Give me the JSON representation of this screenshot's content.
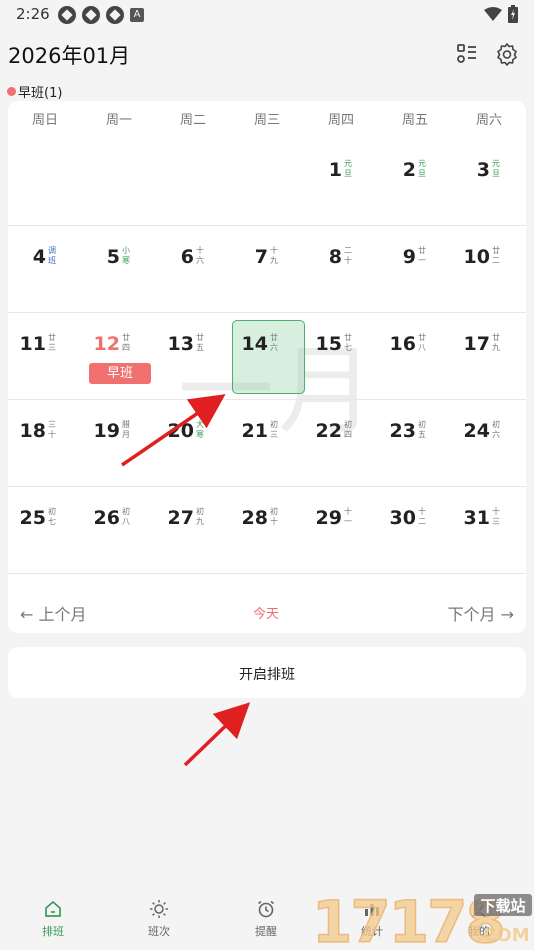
{
  "status_bar": {
    "time": "2:26"
  },
  "header": {
    "title": "2026年01月",
    "layout_icon": "list-grid-icon",
    "settings_icon": "gear-icon"
  },
  "legend": {
    "label": "早班(1)",
    "color": "#f07070"
  },
  "calendar": {
    "weekdays": [
      "周日",
      "周一",
      "周二",
      "周三",
      "周四",
      "周五",
      "周六"
    ],
    "watermark": "一月",
    "weeks": [
      [
        null,
        null,
        null,
        null,
        {
          "day": "1",
          "lunar": "元旦",
          "kind": "festival"
        },
        {
          "day": "2",
          "lunar": "元旦",
          "kind": "festival"
        },
        {
          "day": "3",
          "lunar": "元旦",
          "kind": "festival"
        }
      ],
      [
        {
          "day": "4",
          "lunar": "调班",
          "kind": "holiday"
        },
        {
          "day": "5",
          "lunar": "小寒",
          "kind": "festival"
        },
        {
          "day": "6",
          "lunar": "十六",
          "kind": "normal"
        },
        {
          "day": "7",
          "lunar": "十九",
          "kind": "normal"
        },
        {
          "day": "8",
          "lunar": "二十",
          "kind": "normal"
        },
        {
          "day": "9",
          "lunar": "廿一",
          "kind": "normal"
        },
        {
          "day": "10",
          "lunar": "廿二",
          "kind": "normal"
        }
      ],
      [
        {
          "day": "11",
          "lunar": "廿三",
          "kind": "normal"
        },
        {
          "day": "12",
          "lunar": "廿四",
          "kind": "today",
          "shift": "早班"
        },
        {
          "day": "13",
          "lunar": "廿五",
          "kind": "normal"
        },
        {
          "day": "14",
          "lunar": "廿六",
          "kind": "selected"
        },
        {
          "day": "15",
          "lunar": "廿七",
          "kind": "normal"
        },
        {
          "day": "16",
          "lunar": "廿八",
          "kind": "normal"
        },
        {
          "day": "17",
          "lunar": "廿九",
          "kind": "normal"
        }
      ],
      [
        {
          "day": "18",
          "lunar": "三十",
          "kind": "normal"
        },
        {
          "day": "19",
          "lunar": "腊月",
          "kind": "normal"
        },
        {
          "day": "20",
          "lunar": "大寒",
          "kind": "festival"
        },
        {
          "day": "21",
          "lunar": "初三",
          "kind": "normal"
        },
        {
          "day": "22",
          "lunar": "初四",
          "kind": "normal"
        },
        {
          "day": "23",
          "lunar": "初五",
          "kind": "normal"
        },
        {
          "day": "24",
          "lunar": "初六",
          "kind": "normal"
        }
      ],
      [
        {
          "day": "25",
          "lunar": "初七",
          "kind": "normal"
        },
        {
          "day": "26",
          "lunar": "初八",
          "kind": "normal"
        },
        {
          "day": "27",
          "lunar": "初九",
          "kind": "normal"
        },
        {
          "day": "28",
          "lunar": "初十",
          "kind": "normal"
        },
        {
          "day": "29",
          "lunar": "十一",
          "kind": "normal"
        },
        {
          "day": "30",
          "lunar": "十二",
          "kind": "normal"
        },
        {
          "day": "31",
          "lunar": "十三",
          "kind": "normal"
        }
      ]
    ]
  },
  "month_nav": {
    "prev": "← 上个月",
    "today": "今天",
    "next": "下个月 →"
  },
  "enable_shift": {
    "label": "开启排班"
  },
  "tabbar": {
    "items": [
      {
        "label": "排班",
        "icon": "home-icon",
        "active": true
      },
      {
        "label": "班次",
        "icon": "sun-icon",
        "active": false
      },
      {
        "label": "提醒",
        "icon": "alarm-clock-icon",
        "active": false
      },
      {
        "label": "统计",
        "icon": "chart-icon",
        "active": false
      },
      {
        "label": "我的",
        "icon": "person-icon",
        "active": false
      }
    ]
  },
  "watermark_logo": {
    "text": "17178",
    "sub": "下载站",
    "domain": ".COM"
  },
  "colors": {
    "accent_green": "#3a9a5a",
    "accent_red": "#f07070"
  }
}
